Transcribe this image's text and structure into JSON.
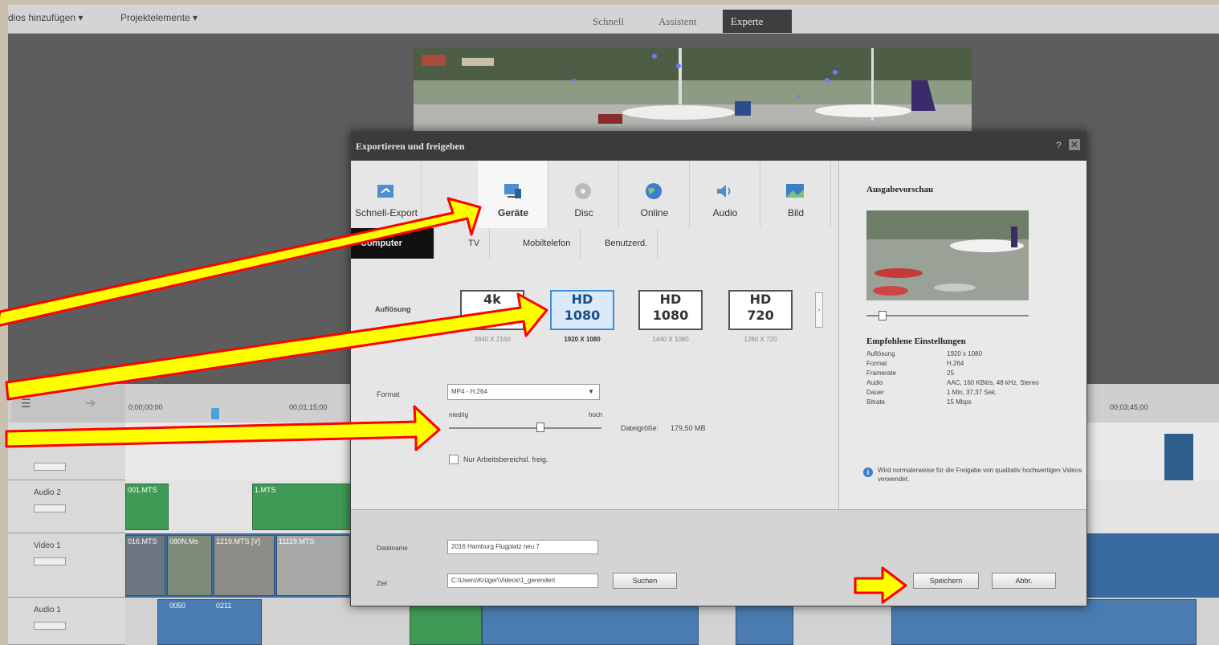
{
  "menubar": {
    "items": [
      "dios hinzufügen ▾",
      "Projektelemente ▾"
    ],
    "modes": [
      "Schnell",
      "Assistent",
      "Experte"
    ],
    "active_mode": "Experte"
  },
  "timeline": {
    "timecodes": [
      "0;00;00;00",
      "00;01;15;00",
      "00;03;45;00"
    ],
    "tracks": [
      "Audio 2",
      "Video 1",
      "Audio 1"
    ],
    "clips": [
      "001.MTS",
      "1.MTS",
      "016.MTS",
      "080N.Ms",
      "1219.MTS [V]",
      "11119.MTS",
      "0050",
      "0211"
    ]
  },
  "dialog": {
    "title": "Exportieren und freigeben",
    "categories": [
      {
        "label": "Schnell-Export",
        "icon": "share-icon"
      },
      {
        "label": "Geräte",
        "icon": "devices-icon"
      },
      {
        "label": "Disc",
        "icon": "disc-icon"
      },
      {
        "label": "Online",
        "icon": "globe-icon"
      },
      {
        "label": "Audio",
        "icon": "speaker-icon"
      },
      {
        "label": "Bild",
        "icon": "image-icon"
      }
    ],
    "active_category": "Geräte",
    "subtabs": [
      "Computer",
      "TV",
      "Mobiltelefon",
      "Benutzerd."
    ],
    "active_subtab": "Computer",
    "resolution_label": "Auflösung",
    "resolutions": [
      {
        "top": "4k",
        "bottom": "",
        "dims": "3840 X 2160"
      },
      {
        "top": "HD",
        "bottom": "1080",
        "dims": "1920 X 1080"
      },
      {
        "top": "HD",
        "bottom": "1080",
        "dims": "1440 X 1080"
      },
      {
        "top": "HD",
        "bottom": "720",
        "dims": "1280 X 720"
      }
    ],
    "selected_resolution": "1920 X 1080",
    "format_label": "Format",
    "format_value": "MP4 - H.264",
    "quality_low": "niedrig",
    "quality_high": "hoch",
    "quality_level": 0.6,
    "filesize_label": "Dateigröße:",
    "filesize_value": "179,50 MB",
    "workarea_label": "Nur Arbeitsbereichsl. freig.",
    "filename_label": "Dateiname",
    "filename_value": "2016 Hamburg Flugplatz neu 7",
    "destination_label": "Ziel",
    "destination_value": "C:\\Users\\Krüger\\Videos\\1_gerendert",
    "browse_label": "Suchen",
    "save_label": "Speichern",
    "cancel_label": "Abbr.",
    "preview_title": "Ausgabevorschau",
    "recommended_title": "Empfohlene Einstellungen",
    "settings": [
      {
        "k": "Auflösung",
        "v": "1920 x 1080"
      },
      {
        "k": "Format",
        "v": "H.264"
      },
      {
        "k": "Framerate",
        "v": "25"
      },
      {
        "k": "Audio",
        "v": "AAC, 160 KBit/s, 48 kHz, Stereo"
      },
      {
        "k": "Dauer",
        "v": "1 Min, 37,37 Sek."
      },
      {
        "k": "Bitrate",
        "v": "15 Mbps"
      }
    ],
    "info_text": "Wird normalerweise für die Freigabe von qualitativ hochwertigen Videos verwendet.",
    "preview_slider_level": 0.1
  },
  "colors": {
    "annotation_arrow_fill": "#ffff00",
    "annotation_arrow_stroke": "#ff0000",
    "selected_blue": "#3b8fd6"
  }
}
